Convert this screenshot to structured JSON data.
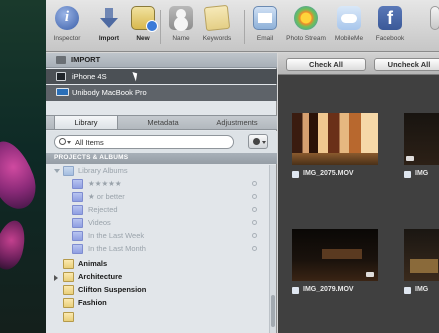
{
  "toolbar": {
    "inspector": "Inspector",
    "import": "Import",
    "new": "New",
    "name": "Name",
    "keywords": "Keywords",
    "email": "Email",
    "photo_stream": "Photo Stream",
    "mobileme": "MobileMe",
    "facebook": "Facebook"
  },
  "sidebar": {
    "import_header": "IMPORT",
    "devices": [
      "iPhone 4S",
      "Unibody MacBook Pro"
    ],
    "tabs": [
      "Library",
      "Metadata",
      "Adjustments"
    ],
    "search_value": "All Items",
    "section_header": "PROJECTS & ALBUMS",
    "library_albums": "Library Albums",
    "smart_albums": [
      "★★★★★",
      "★ or better",
      "Rejected",
      "Videos",
      "In the Last Week",
      "In the Last Month"
    ],
    "albums": [
      "Animals",
      "Architecture",
      "Clifton Suspension",
      "Fashion"
    ]
  },
  "browser": {
    "check_all": "Check All",
    "uncheck_all": "Uncheck All",
    "thumbnails": [
      {
        "name": "IMG_2075.MOV"
      },
      {
        "name": "IMG"
      },
      {
        "name": "IMG_2079.MOV"
      },
      {
        "name": "IMG"
      }
    ]
  },
  "colors": {
    "sidebar_bg": "#e2e6ea",
    "device_bg": "#5e6369",
    "browser_bg": "#404040"
  }
}
